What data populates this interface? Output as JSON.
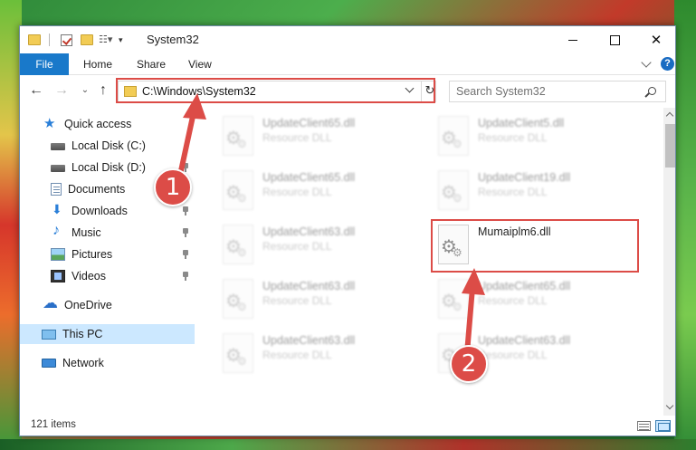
{
  "window": {
    "title": "System32"
  },
  "ribbon": {
    "file": "File",
    "home": "Home",
    "share": "Share",
    "view": "View",
    "help": "?"
  },
  "navigation": {
    "address": "C:\\Windows\\System32",
    "search_placeholder": "Search System32"
  },
  "sidebar": {
    "quick_access": "Quick access",
    "items": [
      {
        "label": "Local Disk (C:)"
      },
      {
        "label": "Local Disk (D:)"
      },
      {
        "label": "Documents"
      },
      {
        "label": "Downloads"
      },
      {
        "label": "Music"
      },
      {
        "label": "Pictures"
      },
      {
        "label": "Videos"
      }
    ],
    "onedrive": "OneDrive",
    "this_pc": "This PC",
    "network": "Network"
  },
  "files": [
    {
      "name": "UpdateClient65.dll",
      "type": "Resource DLL"
    },
    {
      "name": "UpdateClient5.dll",
      "type": "Resource DLL"
    },
    {
      "name": "UpdateClient65.dll",
      "type": "Resource DLL"
    },
    {
      "name": "UpdateClient19.dll",
      "type": "Resource DLL"
    },
    {
      "name": "UpdateClient63.dll",
      "type": "Resource DLL"
    },
    {
      "name": "Mumaiplm6.dll",
      "type": ""
    },
    {
      "name": "UpdateClient63.dll",
      "type": "Resource DLL"
    },
    {
      "name": "UpdateClient65.dll",
      "type": "Resource DLL"
    },
    {
      "name": "UpdateClient63.dll",
      "type": "Resource DLL"
    },
    {
      "name": "UpdateClient63.dll",
      "type": "Resource DLL"
    }
  ],
  "status": {
    "items": "121 items"
  },
  "annotations": {
    "step1": "1",
    "step2": "2",
    "color": "#dc4c47"
  }
}
